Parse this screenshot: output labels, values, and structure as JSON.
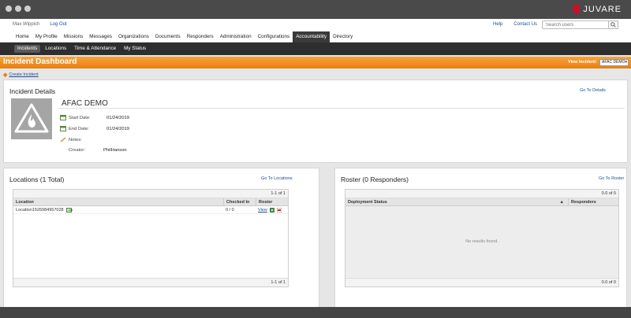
{
  "brand": {
    "name": "JUVARE"
  },
  "topbar": {
    "user_name": "Max Wippich",
    "logout": "Log Out",
    "help": "Help",
    "contact": "Contact Us",
    "search_placeholder": "Search users"
  },
  "main_nav": {
    "items": [
      "Home",
      "My Profile",
      "Missions",
      "Messages",
      "Organizations",
      "Documents",
      "Responders",
      "Administration",
      "Configurations",
      "Accountability",
      "Directory"
    ],
    "active": "Accountability"
  },
  "sub_nav": {
    "items": [
      "Incidents",
      "Locations",
      "Time & Attendance",
      "My Status"
    ],
    "active": "Incidents"
  },
  "dashboard": {
    "title": "Incident Dashboard",
    "view_incident_label": "View Incident:",
    "view_incident_value": "AFAC DEMO"
  },
  "create_incident": "Create Incident",
  "details": {
    "title": "Incident Details",
    "goto": "Go To Details",
    "name": "AFAC DEMO",
    "start_label": "Start Date:",
    "start_value": "01/24/2019",
    "end_label": "End Date:",
    "end_value": "01/24/2019",
    "notes_label": "Notes:",
    "creator_label": "Creator:",
    "creator_value": "PhilHanson"
  },
  "locations": {
    "title": "Locations (1 Total)",
    "goto": "Go To Locations",
    "pager_top": "1-1 of 1",
    "pager_bottom": "1-1 of 1",
    "columns": [
      "Location",
      "Checked In",
      "Roster"
    ],
    "rows": [
      {
        "location": "Location1526984957028",
        "checked_in": "0 / 0",
        "roster_link": "View"
      }
    ]
  },
  "roster": {
    "title": "Roster (0 Responders)",
    "goto": "Go To Roster",
    "pager_top": "0.0 of 0",
    "pager_bottom": "0.0 of 0",
    "columns": [
      "Deployment Status",
      "Responders"
    ],
    "empty": "No results found."
  },
  "colors": {
    "accent": "#e97e0f",
    "link": "#1a4fa0",
    "brand": "#c8102e"
  }
}
